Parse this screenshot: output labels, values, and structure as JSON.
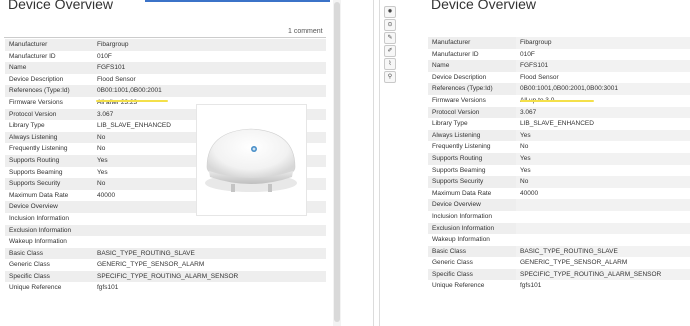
{
  "left": {
    "title": "Device Overview",
    "comment_count": "1 comment",
    "rows": [
      {
        "key": "Manufacturer",
        "value": "Fibargroup"
      },
      {
        "key": "Manufacturer ID",
        "value": "010F"
      },
      {
        "key": "Name",
        "value": "FGFS101"
      },
      {
        "key": "Device Description",
        "value": "Flood Sensor"
      },
      {
        "key": "References (Type:Id)",
        "value": "0B00:1001,0B00:2001"
      },
      {
        "key": "Firmware Versions",
        "value": "All after 23.23"
      },
      {
        "key": "Protocol Version",
        "value": "3.067"
      },
      {
        "key": "Library Type",
        "value": "LIB_SLAVE_ENHANCED"
      },
      {
        "key": "Always Listening",
        "value": "No"
      },
      {
        "key": "Frequently Listening",
        "value": "No"
      },
      {
        "key": "Supports Routing",
        "value": "Yes"
      },
      {
        "key": "Supports Beaming",
        "value": "Yes"
      },
      {
        "key": "Supports Security",
        "value": "No"
      },
      {
        "key": "Maximum Data Rate",
        "value": "40000"
      },
      {
        "key": "Device Overview",
        "value": ""
      },
      {
        "key": "Inclusion Information",
        "value": ""
      },
      {
        "key": "Exclusion Information",
        "value": ""
      },
      {
        "key": "Wakeup Information",
        "value": ""
      },
      {
        "key": "Basic Class",
        "value": "BASIC_TYPE_ROUTING_SLAVE"
      },
      {
        "key": "Generic Class",
        "value": "GENERIC_TYPE_SENSOR_ALARM"
      },
      {
        "key": "Specific Class",
        "value": "SPECIFIC_TYPE_ROUTING_ALARM_SENSOR"
      },
      {
        "key": "Unique Reference",
        "value": "fgfs101"
      }
    ]
  },
  "right": {
    "title": "Device Overview",
    "rows": [
      {
        "key": "Manufacturer",
        "value": "Fibargroup"
      },
      {
        "key": "Manufacturer ID",
        "value": "010F"
      },
      {
        "key": "Name",
        "value": "FGFS101"
      },
      {
        "key": "Device Description",
        "value": "Flood Sensor"
      },
      {
        "key": "References (Type:Id)",
        "value": "0B00:1001,0B00:2001,0B00:3001"
      },
      {
        "key": "Firmware Versions",
        "value": "All up to 3.0"
      },
      {
        "key": "Protocol Version",
        "value": "3.067"
      },
      {
        "key": "Library Type",
        "value": "LIB_SLAVE_ENHANCED"
      },
      {
        "key": "Always Listening",
        "value": "Yes"
      },
      {
        "key": "Frequently Listening",
        "value": "No"
      },
      {
        "key": "Supports Routing",
        "value": "Yes"
      },
      {
        "key": "Supports Beaming",
        "value": "Yes"
      },
      {
        "key": "Supports Security",
        "value": "No"
      },
      {
        "key": "Maximum Data Rate",
        "value": "40000"
      },
      {
        "key": "Device Overview",
        "value": ""
      },
      {
        "key": "Inclusion Information",
        "value": ""
      },
      {
        "key": "Exclusion Information",
        "value": ""
      },
      {
        "key": "Wakeup Information",
        "value": ""
      },
      {
        "key": "Basic Class",
        "value": "BASIC_TYPE_ROUTING_SLAVE"
      },
      {
        "key": "Generic Class",
        "value": "GENERIC_TYPE_SENSOR_ALARM"
      },
      {
        "key": "Specific Class",
        "value": "SPECIFIC_TYPE_ROUTING_ALARM_SENSOR"
      },
      {
        "key": "Unique Reference",
        "value": "fgfs101"
      }
    ]
  },
  "toolbar": {
    "icons": [
      "gear-icon",
      "target-icon",
      "edit-icon",
      "pencil-icon",
      "chart-icon",
      "link-icon"
    ],
    "glyphs": [
      "✹",
      "⊙",
      "✎",
      "✐",
      "⌇",
      "⚲"
    ]
  },
  "colors": {
    "accent": "#3b73c8",
    "highlight": "#f4e04a",
    "row_shade": "#eeeeee"
  }
}
